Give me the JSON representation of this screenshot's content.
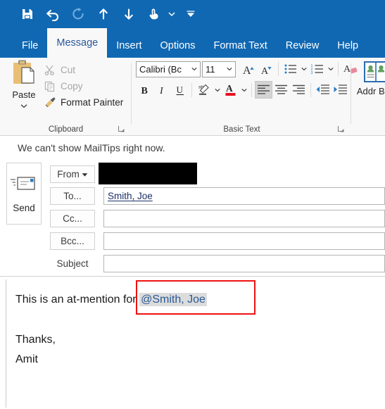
{
  "app": {
    "accent_color": "#1068b3",
    "ribbon_bg": "#f8f8f8"
  },
  "quick_access_toolbar": {
    "buttons": [
      {
        "name": "save-icon",
        "label": "Save",
        "enabled": true
      },
      {
        "name": "undo-icon",
        "label": "Undo",
        "enabled": true
      },
      {
        "name": "redo-icon",
        "label": "Redo",
        "enabled": false
      },
      {
        "name": "previous-item-icon",
        "label": "Previous Item",
        "enabled": true
      },
      {
        "name": "next-item-icon",
        "label": "Next Item",
        "enabled": true
      },
      {
        "name": "touch-mouse-mode-icon",
        "label": "Touch/Mouse Mode",
        "enabled": true
      }
    ],
    "customize_label": "Customize Quick Access Toolbar"
  },
  "ribbon": {
    "tabs": [
      {
        "label": "File",
        "active": false
      },
      {
        "label": "Message",
        "active": true
      },
      {
        "label": "Insert",
        "active": false
      },
      {
        "label": "Options",
        "active": false
      },
      {
        "label": "Format Text",
        "active": false
      },
      {
        "label": "Review",
        "active": false
      },
      {
        "label": "Help",
        "active": false
      }
    ],
    "groups": {
      "clipboard": {
        "label": "Clipboard",
        "paste": {
          "label": "Paste",
          "icon": "paste-icon"
        },
        "items": [
          {
            "label": "Cut",
            "icon": "scissors-icon",
            "enabled": false
          },
          {
            "label": "Copy",
            "icon": "copy-icon",
            "enabled": false
          },
          {
            "label": "Format Painter",
            "icon": "format-painter-icon",
            "enabled": true
          }
        ],
        "dialog_launcher": "clipboard-dialog-launcher"
      },
      "basic_text": {
        "label": "Basic Text",
        "font_name": "Calibri (Bc",
        "font_size": "11",
        "buttons": [
          {
            "name": "grow-font-icon",
            "label": "Increase Font Size"
          },
          {
            "name": "shrink-font-icon",
            "label": "Decrease Font Size"
          },
          {
            "name": "bullets-icon",
            "label": "Bullets"
          },
          {
            "name": "numbering-icon",
            "label": "Numbering"
          },
          {
            "name": "clear-formatting-icon",
            "label": "Clear All Formatting"
          },
          {
            "name": "bold-icon",
            "label": "B"
          },
          {
            "name": "italic-icon",
            "label": "I"
          },
          {
            "name": "underline-icon",
            "label": "U"
          },
          {
            "name": "text-highlight-icon",
            "label": "Text Highlight Color"
          },
          {
            "name": "font-color-icon",
            "label": "Font Color"
          },
          {
            "name": "align-left-icon",
            "label": "Align Left"
          },
          {
            "name": "align-center-icon",
            "label": "Center"
          },
          {
            "name": "align-right-icon",
            "label": "Align Right"
          },
          {
            "name": "decrease-indent-icon",
            "label": "Decrease Indent"
          },
          {
            "name": "increase-indent-icon",
            "label": "Increase Indent"
          }
        ],
        "dialog_launcher": "basic-text-dialog-launcher"
      },
      "names": {
        "address_book_label": "Addr\nBoo"
      }
    }
  },
  "mailtips": {
    "message": "We can't show MailTips right now."
  },
  "compose": {
    "send_label": "Send",
    "from_label": "From",
    "from_value": "",
    "to_label": "To...",
    "to_value": "Smith, Joe",
    "cc_label": "Cc...",
    "cc_value": "",
    "bcc_label": "Bcc...",
    "bcc_value": "",
    "subject_label": "Subject",
    "subject_value": ""
  },
  "body": {
    "line1_prefix": "This is an at-mention for ",
    "mention": "@Smith, Joe",
    "signature_line1": "Thanks,",
    "signature_line2": "Amit"
  },
  "annotation": {
    "color": "#ee1111",
    "target": "at-mention-highlight"
  }
}
